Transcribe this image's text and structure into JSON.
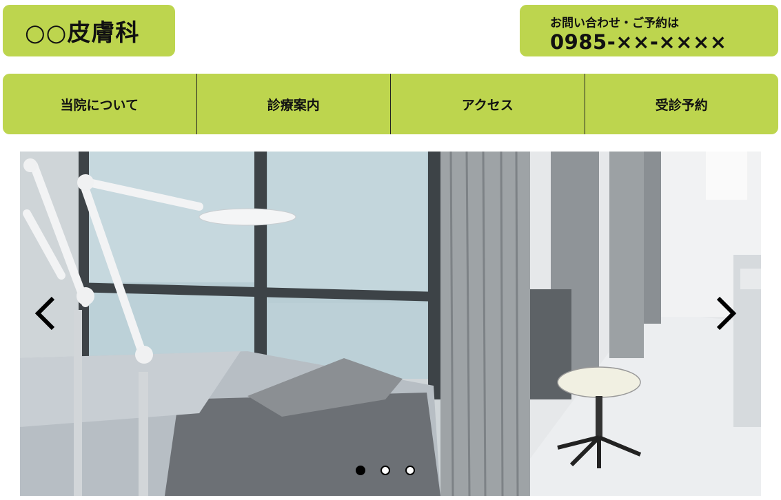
{
  "header": {
    "logo_text": "○○皮膚科",
    "contact_label": "お問い合わせ・ご予約は",
    "phone": "0985-××-××××"
  },
  "nav": {
    "items": [
      {
        "label": "当院について"
      },
      {
        "label": "診療案内"
      },
      {
        "label": "アクセス"
      },
      {
        "label": "受診予約"
      }
    ]
  },
  "slider": {
    "slide_count": 3,
    "active_index": 0,
    "image_description_icon": "clinic-treatment-room-photo",
    "prev_icon": "chevron-left-icon",
    "next_icon": "chevron-right-icon"
  },
  "colors": {
    "accent": "#bdd54e",
    "text": "#111111"
  }
}
